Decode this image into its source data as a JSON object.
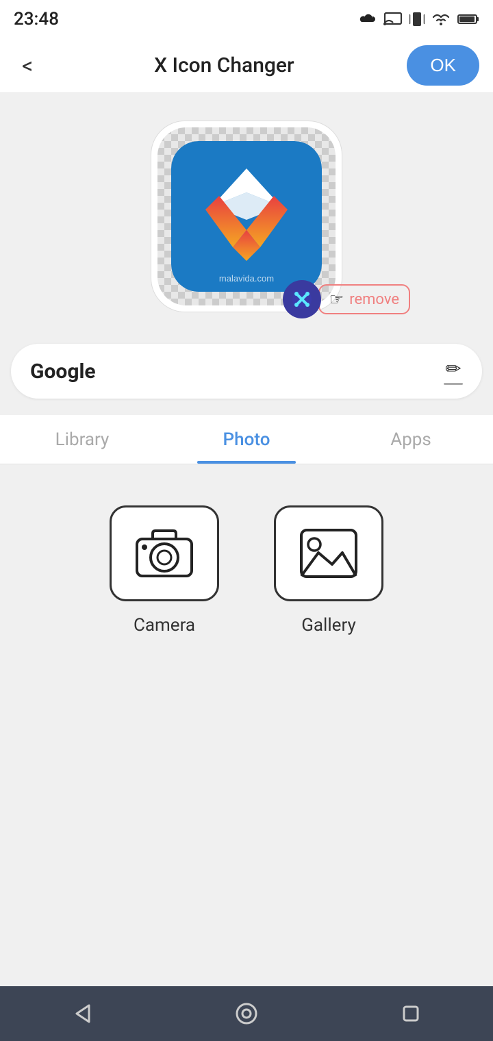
{
  "statusBar": {
    "time": "23:48",
    "cloudIconLabel": "cloud-icon",
    "castIconLabel": "cast-icon",
    "vibrateIconLabel": "vibrate-icon",
    "wifiIconLabel": "wifi-icon",
    "batteryIconLabel": "battery-icon"
  },
  "topNav": {
    "backLabel": "<",
    "title": "X Icon Changer",
    "okLabel": "OK"
  },
  "iconPreview": {
    "watermarkText": "malavida.com",
    "removeLabel": "remove"
  },
  "nameField": {
    "appName": "Google",
    "editIconLabel": "edit-icon"
  },
  "tabs": [
    {
      "id": "library",
      "label": "Library",
      "active": false
    },
    {
      "id": "photo",
      "label": "Photo",
      "active": true
    },
    {
      "id": "apps",
      "label": "Apps",
      "active": false
    }
  ],
  "photoContent": {
    "cameraLabel": "Camera",
    "galleryLabel": "Gallery"
  },
  "bottomNav": {
    "backLabel": "back-nav",
    "homeLabel": "home-nav",
    "recentLabel": "recent-nav"
  }
}
